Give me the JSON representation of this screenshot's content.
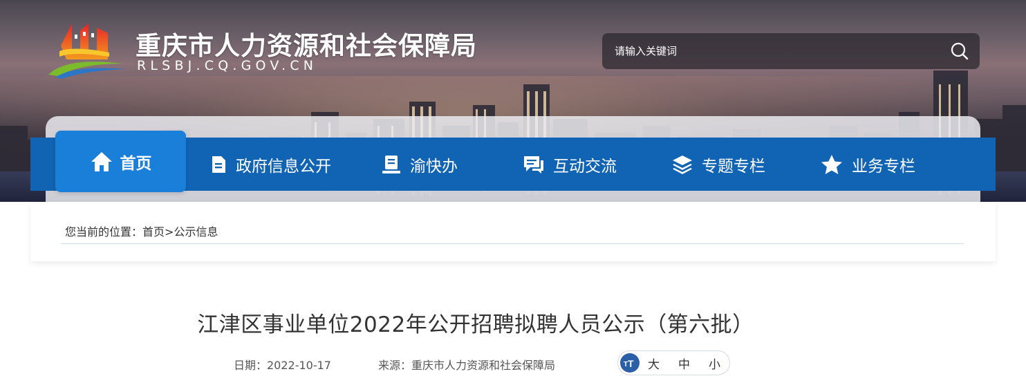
{
  "header": {
    "site_title": "重庆市人力资源和社会保障局",
    "site_domain": "RLSBJ.CQ.GOV.CN"
  },
  "search": {
    "placeholder": "请输入关键词",
    "icon": "search-icon"
  },
  "nav": {
    "items": [
      {
        "label": "首页",
        "icon": "home-icon",
        "active": true
      },
      {
        "label": "政府信息公开",
        "icon": "document-icon"
      },
      {
        "label": "渝快办",
        "icon": "service-desk-icon"
      },
      {
        "label": "互动交流",
        "icon": "chat-icon"
      },
      {
        "label": "专题专栏",
        "icon": "layers-icon"
      },
      {
        "label": "业务专栏",
        "icon": "star-icon"
      }
    ]
  },
  "breadcrumb": {
    "prefix": "您当前的位置：",
    "home": "首页",
    "separator": ">",
    "current": "公示信息"
  },
  "article": {
    "title": "江津区事业单位2022年公开招聘拟聘人员公示（第六批）",
    "date_label": "日期：2022-10-17",
    "source_label": "来源：重庆市人力资源和社会保障局",
    "font_size": {
      "icon": "font-size-icon",
      "large": "大",
      "medium": "中",
      "small": "小"
    }
  },
  "colors": {
    "nav_bar": "#1164b4",
    "nav_active": "#1a7fd8",
    "breadcrumb_rule": "#c9dcf0"
  }
}
